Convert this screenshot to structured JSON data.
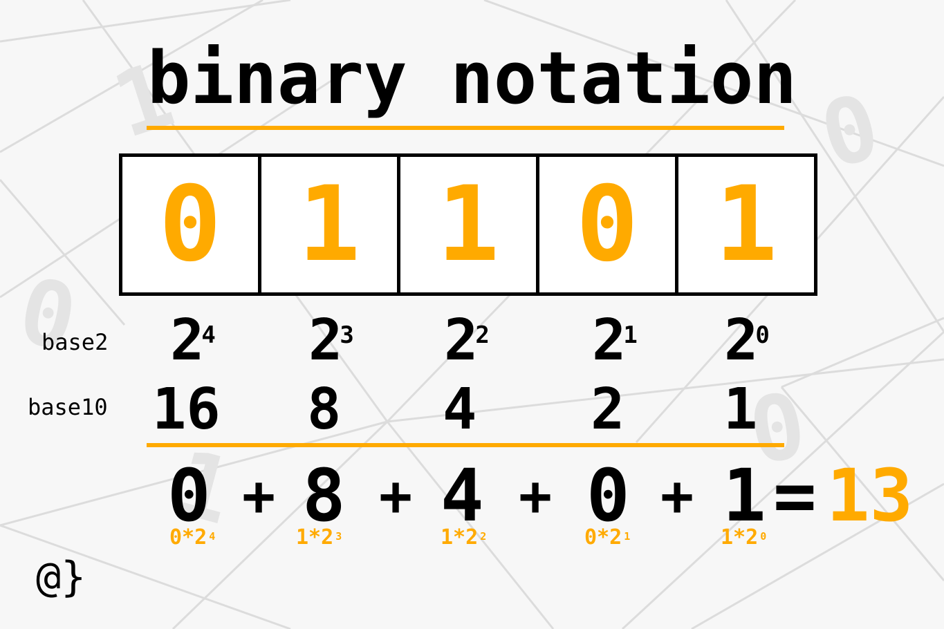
{
  "title": "binary notation",
  "bits": [
    "0",
    "1",
    "1",
    "0",
    "1"
  ],
  "labels": {
    "base2": "base2",
    "base10": "base10"
  },
  "powers": [
    {
      "base": "2",
      "exp": "4"
    },
    {
      "base": "2",
      "exp": "3"
    },
    {
      "base": "2",
      "exp": "2"
    },
    {
      "base": "2",
      "exp": "1"
    },
    {
      "base": "2",
      "exp": "0"
    }
  ],
  "decimals": [
    "16",
    "8",
    "4",
    "2",
    "1"
  ],
  "terms": [
    "0",
    "8",
    "4",
    "0",
    "1"
  ],
  "plus": "+",
  "equals": "=",
  "result": "13",
  "subterms": [
    {
      "text": "0*2",
      "exp": "4"
    },
    {
      "text": "1*2",
      "exp": "3"
    },
    {
      "text": "1*2",
      "exp": "2"
    },
    {
      "text": "0*2",
      "exp": "1"
    },
    {
      "text": "1*2",
      "exp": "0"
    }
  ],
  "logo": "@}",
  "colors": {
    "accent": "#ffaa00",
    "ink": "#000000",
    "background": "#f7f7f7"
  }
}
